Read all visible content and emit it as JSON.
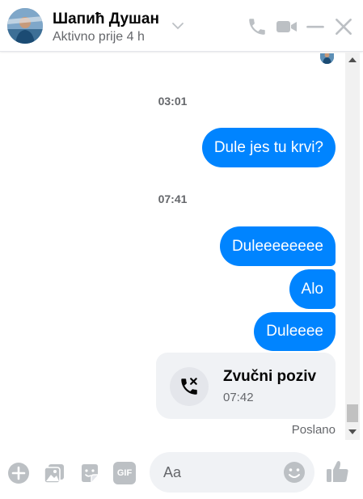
{
  "header": {
    "contact_name": "Шапић Душан",
    "status": "Aktivno prije 4 h"
  },
  "conversation": {
    "time_separators": [
      "03:01",
      "07:41"
    ],
    "messages": [
      {
        "text": "Dule jes tu krvi?",
        "from": "me"
      },
      {
        "text": "Duleeeeeeee",
        "from": "me"
      },
      {
        "text": "Alo",
        "from": "me"
      },
      {
        "text": "Duleeee",
        "from": "me"
      }
    ],
    "call": {
      "title": "Zvučni poziv",
      "time": "07:42",
      "icon": "missed-call-icon"
    },
    "delivery_status": "Poslano"
  },
  "composer": {
    "placeholder": "Aa",
    "gif_label": "GIF"
  },
  "icons": [
    "phone-icon",
    "video-icon",
    "minimize-icon",
    "close-icon",
    "chevron-down-icon",
    "plus-icon",
    "image-icon",
    "sticker-icon",
    "gif-icon",
    "emoji-icon",
    "like-icon"
  ],
  "colors": {
    "accent": "#0084ff",
    "icon_gray": "#bcc0c4",
    "bubble_gray": "#f0f2f5",
    "text_secondary": "#65676b"
  }
}
